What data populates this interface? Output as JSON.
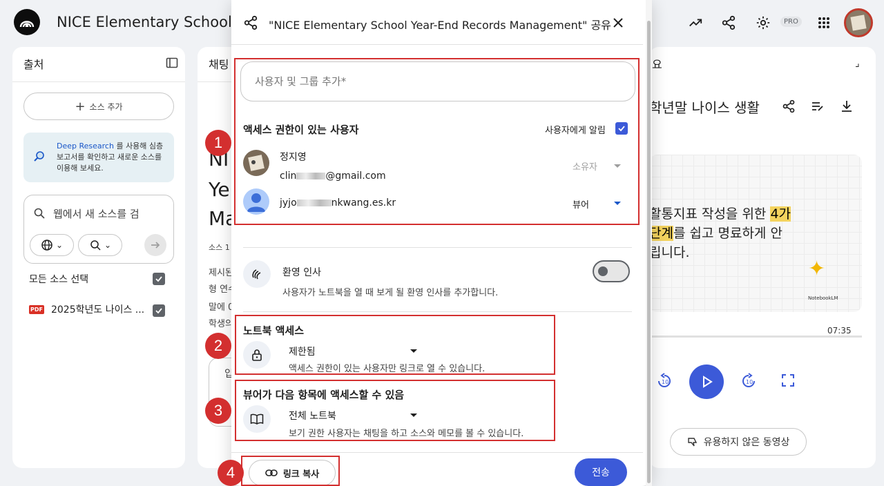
{
  "header": {
    "app_title": "NICE Elementary School Y",
    "pro_badge": "PRO",
    "icons": [
      "analytics-icon",
      "share-icon",
      "settings-icon",
      "apps-grid-icon"
    ]
  },
  "sources_panel": {
    "title": "출처",
    "add_source": "소스 추가",
    "research_link": "Deep Research",
    "research_text": " 를 사용해 심층 보고서를 확인하고 새로운 소스를 이용해 보세요.",
    "web_search_placeholder": "웹에서 새 소스를 검",
    "select_all": "모든 소스 선택",
    "sources": [
      {
        "name": "2025학년도 나이스 ...",
        "type": "PDF"
      }
    ]
  },
  "chat_panel": {
    "title": "채팅",
    "heading_lines": [
      "NI",
      "Ye",
      "Ma"
    ],
    "source_count": "소스 1",
    "body_lines": [
      "제시된",
      "형 연수",
      "말에 0",
      "학생의"
    ],
    "input_stub": "입"
  },
  "studio_panel": {
    "title_fragment": "요",
    "overview_title": "학년말 나이스 생활",
    "video_text_line1_pre": "활통지표 작성을 위한 ",
    "video_text_line1_hl": "4가",
    "video_text_line2_hl": "단계",
    "video_text_line2_post": "를 쉽고 명료하게 안",
    "video_text_line3": "립니다.",
    "notebook_logo": "NotebookLM",
    "duration": "07:35",
    "feedback": "유용하지 않은 동영상"
  },
  "share_dialog": {
    "title": "\"NICE Elementary School Year-End Records Management\" 공유",
    "add_people_placeholder": "사용자 및 그룹 추가*",
    "access_heading": "액세스 권한이 있는 사용자",
    "notify_label": "사용자에게 알림",
    "users": [
      {
        "name": "정지영",
        "email_prefix": "clin",
        "email_suffix": "@gmail.com",
        "role": "소유자"
      },
      {
        "name": "",
        "email_prefix": "jyjo",
        "email_suffix": "nkwang.es.kr",
        "role": "뷰어"
      }
    ],
    "welcome": {
      "title": "환영 인사",
      "desc": "사용자가 노트북을 열 때 보게 될 환영 인사를 추가합니다."
    },
    "notebook_access": {
      "heading": "노트북 액세스",
      "value": "제한됨",
      "desc": "액세스 권한이 있는 사용자만 링크로 열 수 있습니다."
    },
    "viewer_access": {
      "heading": "뷰어가 다음 항목에 액세스할 수 있음",
      "value": "전체 노트북",
      "desc": "보기 권한 사용자는 채팅을 하고 소스와 메모를 볼 수 있습니다."
    },
    "copy_link": "링크 복사",
    "send": "전송"
  },
  "annotations": [
    "1",
    "2",
    "3",
    "4"
  ],
  "colors": {
    "accent": "#3c5ad8",
    "annotation": "#d32f2f",
    "highlight": "#f4d35e"
  }
}
